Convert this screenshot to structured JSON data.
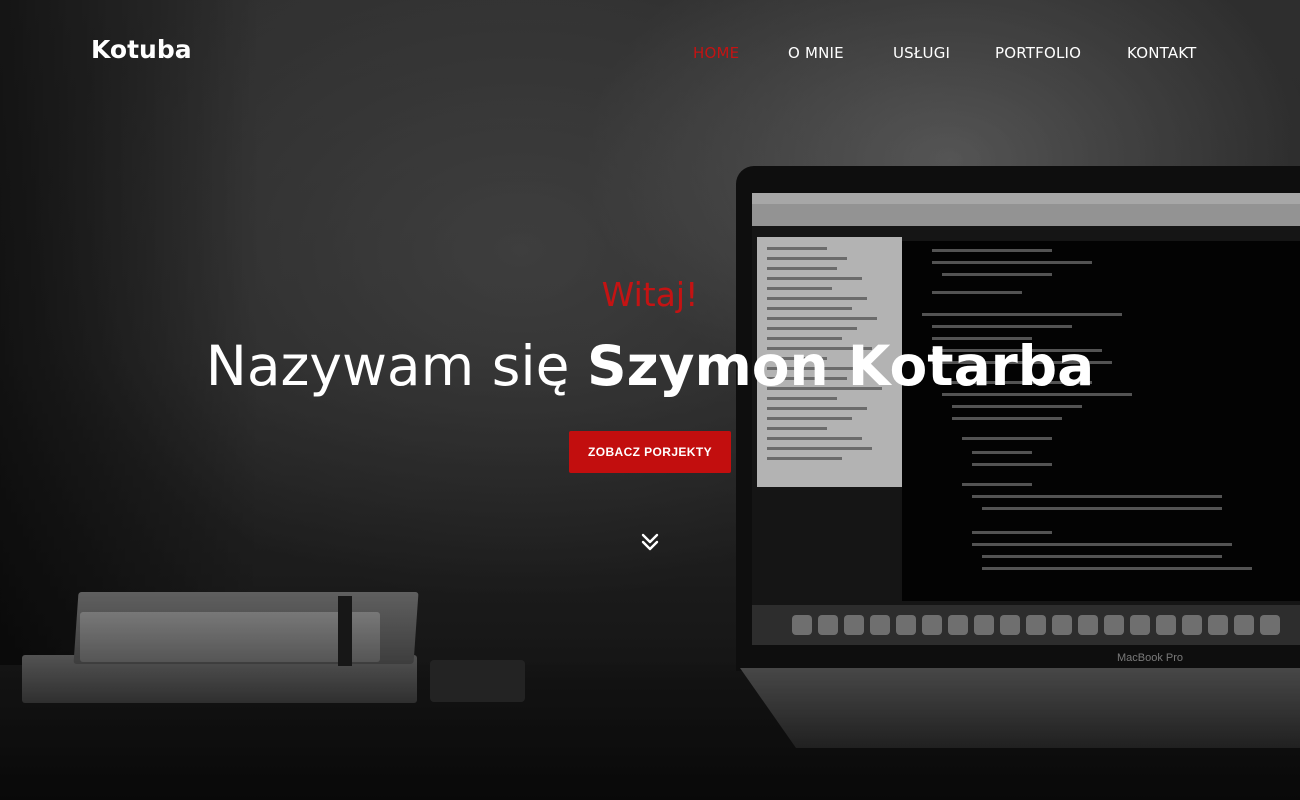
{
  "header": {
    "brand": "Kotuba",
    "nav": [
      {
        "label": "HOME",
        "active": true
      },
      {
        "label": "O MNIE",
        "active": false
      },
      {
        "label": "USŁUGI",
        "active": false
      },
      {
        "label": "PORTFOLIO",
        "active": false
      },
      {
        "label": "KONTAKT",
        "active": false
      }
    ]
  },
  "hero": {
    "greeting": "Witaj!",
    "heading_prefix": "Nazywam się ",
    "heading_name": "Szymon Kotarba",
    "cta_label": "ZOBACZ PORJEKTY"
  },
  "background": {
    "laptop_brand": "MacBook Pro"
  },
  "colors": {
    "accent": "#c41313",
    "button": "#c20e0e",
    "text": "#ffffff"
  },
  "icons": {
    "scroll_down": "double-chevron-down-icon"
  }
}
